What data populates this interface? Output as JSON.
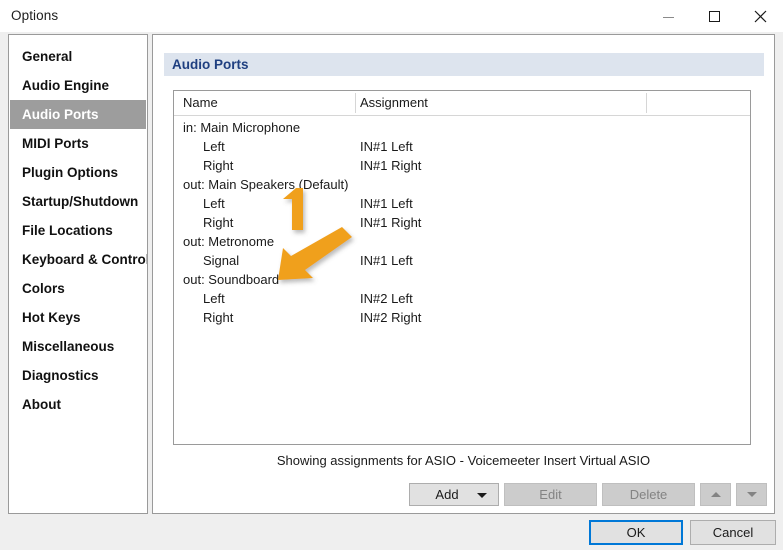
{
  "window": {
    "title": "Options",
    "controls": [
      {
        "name": "minimize-button",
        "glyph": "minimize"
      },
      {
        "name": "maximize-button",
        "glyph": "maximize"
      },
      {
        "name": "close-button",
        "glyph": "close"
      }
    ]
  },
  "sidebar": {
    "items": [
      {
        "label": "General",
        "selected": false
      },
      {
        "label": "Audio Engine",
        "selected": false
      },
      {
        "label": "Audio Ports",
        "selected": true
      },
      {
        "label": "MIDI Ports",
        "selected": false
      },
      {
        "label": "Plugin Options",
        "selected": false
      },
      {
        "label": "Startup/Shutdown",
        "selected": false
      },
      {
        "label": "File Locations",
        "selected": false
      },
      {
        "label": "Keyboard & Controls",
        "selected": false
      },
      {
        "label": "Colors",
        "selected": false
      },
      {
        "label": "Hot Keys",
        "selected": false
      },
      {
        "label": "Miscellaneous",
        "selected": false
      },
      {
        "label": "Diagnostics",
        "selected": false
      },
      {
        "label": "About",
        "selected": false
      }
    ]
  },
  "main": {
    "header": "Audio Ports",
    "list": {
      "columns": [
        "Name",
        "Assignment"
      ],
      "rows": [
        {
          "name": "in: Main Microphone",
          "assignment": "",
          "child": false
        },
        {
          "name": "Left",
          "assignment": "IN#1 Left",
          "child": true
        },
        {
          "name": "Right",
          "assignment": "IN#1 Right",
          "child": true
        },
        {
          "name": "out: Main Speakers (Default)",
          "assignment": "",
          "child": false
        },
        {
          "name": "Left",
          "assignment": "IN#1 Left",
          "child": true
        },
        {
          "name": "Right",
          "assignment": "IN#1 Right",
          "child": true
        },
        {
          "name": "out: Metronome",
          "assignment": "",
          "child": false
        },
        {
          "name": "Signal",
          "assignment": "IN#1 Left",
          "child": true
        },
        {
          "name": "out: Soundboard",
          "assignment": "",
          "child": false
        },
        {
          "name": "Left",
          "assignment": "IN#2 Left",
          "child": true
        },
        {
          "name": "Right",
          "assignment": "IN#2 Right",
          "child": true
        }
      ]
    },
    "status": "Showing assignments for ASIO - Voicemeeter Insert Virtual ASIO",
    "buttons": {
      "add": "Add",
      "edit": "Edit",
      "delete": "Delete",
      "move_up_icon": "arrow-up-icon",
      "move_down_icon": "arrow-down-icon"
    }
  },
  "footer": {
    "ok": "OK",
    "cancel": "Cancel"
  },
  "annotation": {
    "step_number": "1",
    "color": "#F0A01E",
    "points_at": "out: Soundboard"
  }
}
